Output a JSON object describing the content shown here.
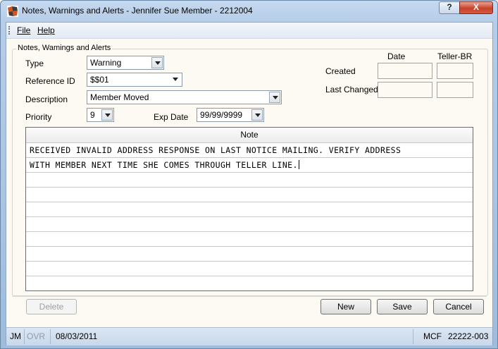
{
  "window": {
    "title": "Notes, Warnings and Alerts - Jennifer Sue Member - 2212004",
    "help_button": "?",
    "close_button": "X"
  },
  "menu": {
    "file": "File",
    "help": "Help"
  },
  "group": {
    "legend": "Notes, Wamings and Alerts",
    "type_label": "Type",
    "type_value": "Warning",
    "reference_label": "Reference ID",
    "reference_value": "$$01",
    "description_label": "Description",
    "description_value": "Member Moved",
    "priority_label": "Priority",
    "priority_value": "9",
    "exp_date_label": "Exp Date",
    "exp_date_value": "99/99/9999",
    "date_header": "Date",
    "teller_header": "Teller-BR",
    "created_label": "Created",
    "last_changed_label": "Last Changed",
    "created_date": "",
    "created_teller": "",
    "changed_date": "",
    "changed_teller": ""
  },
  "note": {
    "header": "Note",
    "lines": [
      "RECEIVED INVALID ADDRESS RESPONSE ON LAST NOTICE MAILING. VERIFY ADDRESS",
      "WITH MEMBER NEXT TIME SHE COMES THROUGH TELLER LINE.",
      "",
      "",
      "",
      "",
      "",
      "",
      "",
      ""
    ]
  },
  "buttons": {
    "delete": "Delete",
    "new": "New",
    "save": "Save",
    "cancel": "Cancel"
  },
  "status": {
    "user": "JM",
    "ovr": "OVR",
    "date": "08/03/2011",
    "app": "MCF",
    "code": "22222-003"
  }
}
